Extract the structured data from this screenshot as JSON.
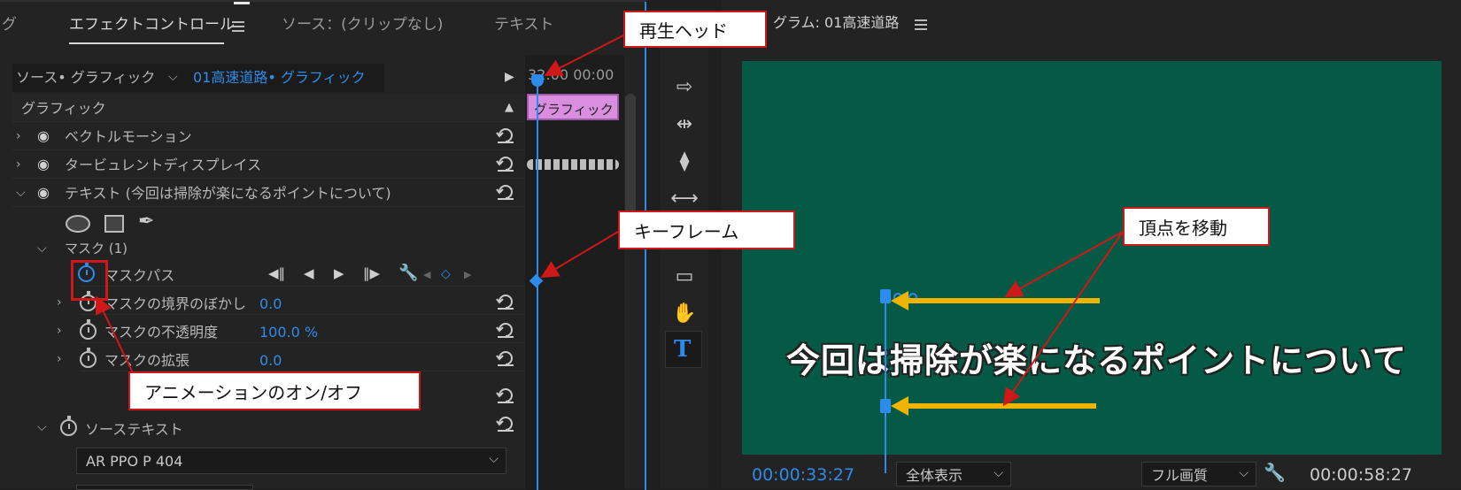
{
  "effect_controls": {
    "partial_tab": "グ",
    "active_tab": "エフェクトコントロール",
    "tab_source": "ソース：(クリップなし)",
    "tab_text": "テキスト",
    "source_label": "ソース• グラフィック",
    "source_clip": "01高速道路• グラフィック",
    "timeline_time": "32:00 00:00",
    "clip_name": "グラフィック",
    "section_graphic": "グラフィック",
    "effect_vector": "ベクトルモーション",
    "effect_turbulent": "タービュレントディスプレイス",
    "effect_text": "テキスト (今回は掃除が楽になるポイントについて)",
    "mask_group": "マスク (1)",
    "mask_path": "マスクパス",
    "mask_feather": "マスクの境界のぼかし",
    "mask_feather_value": "0.0",
    "mask_opacity": "マスクの不透明度",
    "mask_opacity_value": "100.0 %",
    "mask_expansion": "マスクの拡張",
    "mask_expansion_value": "0.0",
    "source_text": "ソーステキスト",
    "font_name": "AR PPO P 404"
  },
  "program_monitor": {
    "title": "グラム: 01高速道路",
    "current_time": "00:00:33:27",
    "zoom": "全体表示",
    "quality": "フル画質",
    "duration": "00:00:58:27",
    "caption": "今回は掃除が楽になるポイントについて"
  },
  "callouts": {
    "playhead": "再生ヘッド",
    "keyframe": "キーフレーム",
    "move_vertex": "頂点を移動",
    "anim_toggle": "アニメーションのオン/オフ"
  },
  "colors": {
    "accent_blue": "#2d8ceb",
    "video_bg": "#055a45",
    "clip_pink": "#d98ee0",
    "arrow_yellow": "#f0b400",
    "callout_red": "#d01818"
  }
}
